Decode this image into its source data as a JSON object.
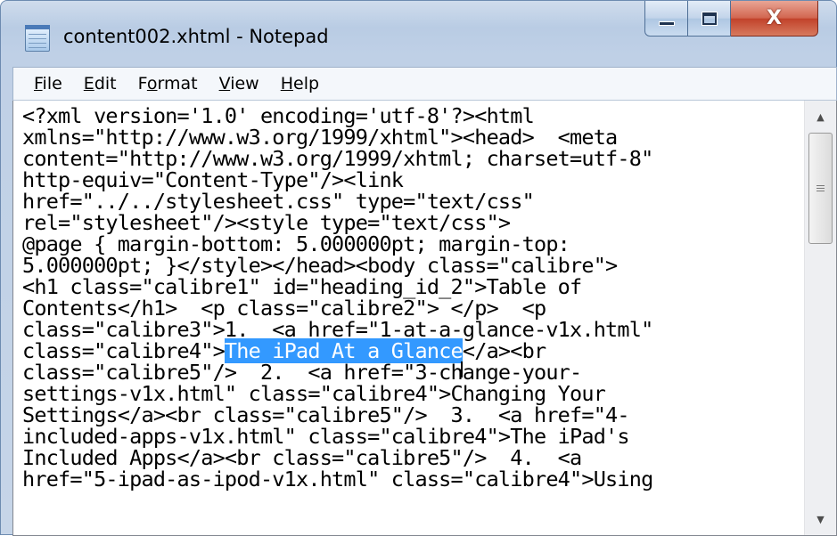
{
  "window": {
    "title": "content002.xhtml - Notepad"
  },
  "controls": {
    "close_glyph": "X"
  },
  "menu": [
    {
      "label_first": "F",
      "label_rest": "ile"
    },
    {
      "label_first": "E",
      "label_rest": "dit"
    },
    {
      "label_pre": "F",
      "label_first": "o",
      "label_rest": "rmat"
    },
    {
      "label_first": "V",
      "label_rest": "iew"
    },
    {
      "label_first": "H",
      "label_rest": "elp"
    }
  ],
  "document": {
    "lines": [
      "<?xml version='1.0' encoding='utf-8'?><html",
      "xmlns=\"http://www.w3.org/1999/xhtml\"><head>  <meta",
      "content=\"http://www.w3.org/1999/xhtml; charset=utf-8\"",
      "http-equiv=\"Content-Type\"/><link",
      "href=\"../../stylesheet.css\" type=\"text/css\"",
      "rel=\"stylesheet\"/><style type=\"text/css\">",
      "@page { margin-bottom: 5.000000pt; margin-top:",
      "5.000000pt; }</style></head><body class=\"calibre\">",
      "<h1 class=\"calibre1\" id=\"heading_id_2\">Table of",
      "Contents</h1>  <p class=\"calibre2\"> </p>  <p",
      "class=\"calibre3\">1.  <a href=\"1-at-a-glance-v1x.html\""
    ],
    "selected_line_before": "class=\"calibre4\">",
    "selected_text": "The iPad At a Glance",
    "selected_line_after": "</a><br",
    "lines_after": [
      "class=\"calibre5\"/>  2.  <a href=\"3-change-your-",
      "settings-v1x.html\" class=\"calibre4\">Changing Your",
      "Settings</a><br class=\"calibre5\"/>  3.  <a href=\"4-",
      "included-apps-v1x.html\" class=\"calibre4\">The iPad's",
      "Included Apps</a><br class=\"calibre5\"/>  4.  <a",
      "href=\"5-ipad-as-ipod-v1x.html\" class=\"calibre4\">Using"
    ]
  },
  "colors": {
    "selection": "#3399ff",
    "close_button": "#c1412a"
  },
  "icons": {
    "app": "notepad-icon",
    "scroll_up": "up-arrow-icon",
    "scroll_down": "down-arrow-icon"
  }
}
